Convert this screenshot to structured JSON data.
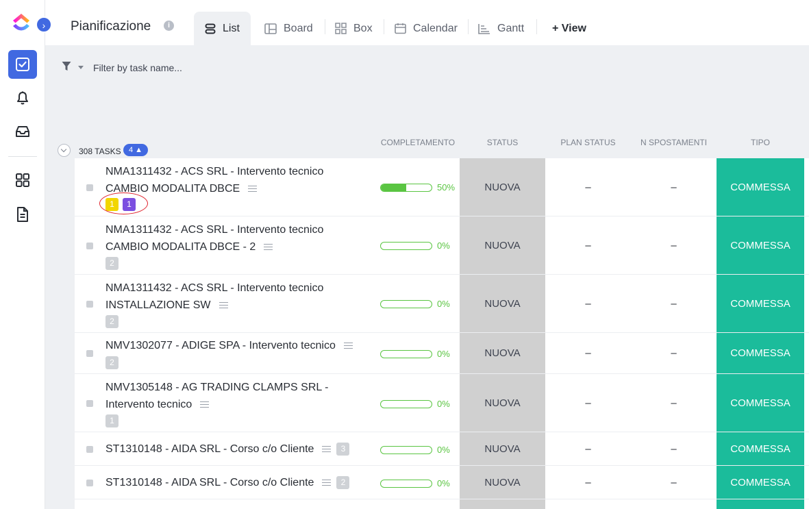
{
  "header": {
    "title": "Pianificazione",
    "info": "i",
    "tabs": [
      {
        "label": "List",
        "icon": "list-icon",
        "active": true
      },
      {
        "label": "Board",
        "icon": "board-icon"
      },
      {
        "label": "Box",
        "icon": "box-icon"
      },
      {
        "label": "Calendar",
        "icon": "calendar-icon"
      },
      {
        "label": "Gantt",
        "icon": "gantt-icon"
      }
    ],
    "add_view": "+ View"
  },
  "sidebar": {
    "expand": "›",
    "items": [
      {
        "icon": "tasks-check-icon",
        "active": true
      },
      {
        "icon": "bell-icon"
      },
      {
        "icon": "inbox-icon"
      },
      {
        "icon": "dashboard-icon"
      },
      {
        "icon": "document-icon"
      }
    ]
  },
  "filter": {
    "placeholder": "Filter by task name..."
  },
  "group": {
    "count_label": "308 TASKS",
    "badge": "4 ▲"
  },
  "columns": {
    "completamento": "COMPLETAMENTO",
    "status": "STATUS",
    "plan_status": "PLAN STATUS",
    "n_spostamenti": "N SPOSTAMENTI",
    "tipo": "TIPO"
  },
  "tasks": [
    {
      "line1": "NMA1311432 - ACS SRL - Intervento tecnico",
      "line2": "CAMBIO MODALITA DBCE",
      "badges": [
        "1",
        "1"
      ],
      "progress": 50,
      "pct": "50%",
      "status": "NUOVA",
      "plan_status": "–",
      "n_spostamenti": "–",
      "tipo": "COMMESSA"
    },
    {
      "line1": "NMA1311432 - ACS SRL - Intervento tecnico",
      "line2": "CAMBIO MODALITA DBCE - 2",
      "badges": [
        "2"
      ],
      "progress": 0,
      "pct": "0%",
      "status": "NUOVA",
      "plan_status": "–",
      "n_spostamenti": "–",
      "tipo": "COMMESSA"
    },
    {
      "line1": "NMA1311432 - ACS SRL - Intervento tecnico",
      "line2": "INSTALLAZIONE SW",
      "badges": [
        "2"
      ],
      "progress": 0,
      "pct": "0%",
      "status": "NUOVA",
      "plan_status": "–",
      "n_spostamenti": "–",
      "tipo": "COMMESSA"
    },
    {
      "line1": "NMV1302077 - ADIGE SPA - Intervento tecnico",
      "badges": [
        "2"
      ],
      "progress": 0,
      "pct": "0%",
      "status": "NUOVA",
      "plan_status": "–",
      "n_spostamenti": "–",
      "tipo": "COMMESSA"
    },
    {
      "line1": "NMV1305148 - AG TRADING CLAMPS SRL -",
      "line2": "Intervento tecnico",
      "badges": [
        "1"
      ],
      "progress": 0,
      "pct": "0%",
      "status": "NUOVA",
      "plan_status": "–",
      "n_spostamenti": "–",
      "tipo": "COMMESSA"
    },
    {
      "line1": "ST1310148 - AIDA SRL - Corso c/o Cliente",
      "inline_badge": "3",
      "progress": 0,
      "pct": "0%",
      "status": "NUOVA",
      "plan_status": "–",
      "n_spostamenti": "–",
      "tipo": "COMMESSA"
    },
    {
      "line1": "ST1310148 - AIDA SRL - Corso c/o Cliente",
      "inline_badge": "2",
      "progress": 0,
      "pct": "0%",
      "status": "NUOVA",
      "plan_status": "–",
      "n_spostamenti": "–",
      "tipo": "COMMESSA"
    }
  ],
  "colors": {
    "accent": "#4169e1",
    "progress": "#5ac542",
    "tipo": "#1bbc9b",
    "status_bg": "#d0d0d0"
  }
}
